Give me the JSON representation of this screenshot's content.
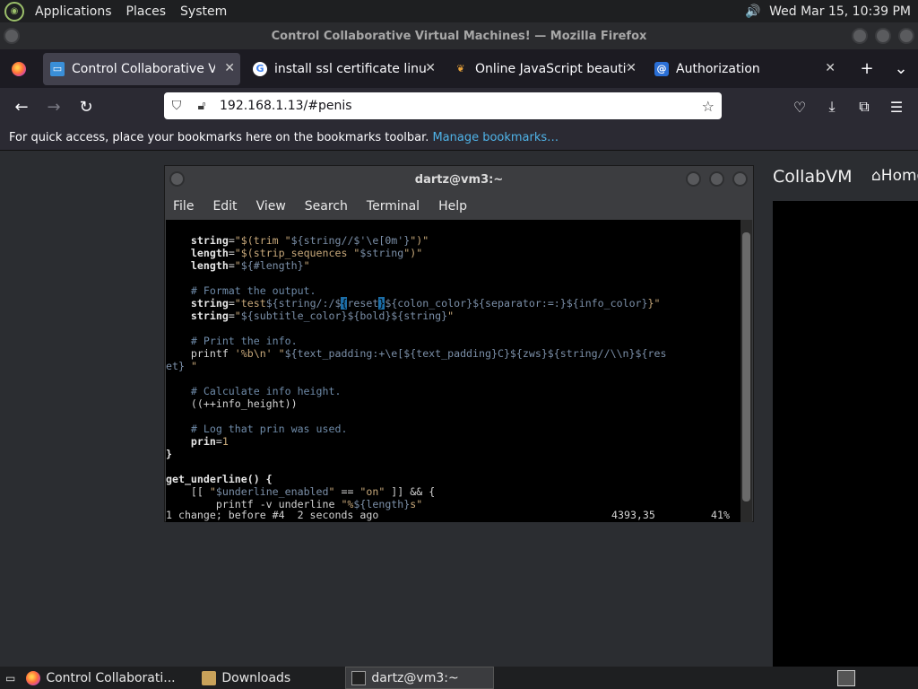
{
  "panel": {
    "menus": [
      "Applications",
      "Places",
      "System"
    ],
    "clock": "Wed Mar 15, 10:39 PM"
  },
  "window": {
    "title": "Control Collaborative Virtual Machines! — Mozilla Firefox"
  },
  "tabs": [
    {
      "label": "Control Collaborative Virtual Machines!",
      "active": true
    },
    {
      "label": "install ssl certificate linux - Google Search",
      "active": false
    },
    {
      "label": "Online JavaScript beautifier",
      "active": false
    },
    {
      "label": "Authorization",
      "active": false
    }
  ],
  "navbar": {
    "url": "192.168.1.13/#penis"
  },
  "bookmarks": {
    "message": "For quick access, place your bookmarks here on the bookmarks toolbar.",
    "link": "Manage bookmarks…"
  },
  "collabvm": {
    "brand": "CollabVM",
    "home": "Home"
  },
  "terminal": {
    "title": "dartz@vm3:~",
    "menus": [
      "File",
      "Edit",
      "View",
      "Search",
      "Terminal",
      "Help"
    ],
    "status_left": "1 change; before #4  2 seconds ago",
    "status_pos": "4393,35",
    "status_pct": "41%"
  },
  "taskbar": {
    "items": [
      "Control Collaborati...",
      "Downloads",
      "dartz@vm3:~"
    ]
  },
  "colors": {
    "accent": "#4fb3e8",
    "terminal_bg": "#000000",
    "string": "#c7a87a",
    "comment": "#6e8aa8"
  }
}
